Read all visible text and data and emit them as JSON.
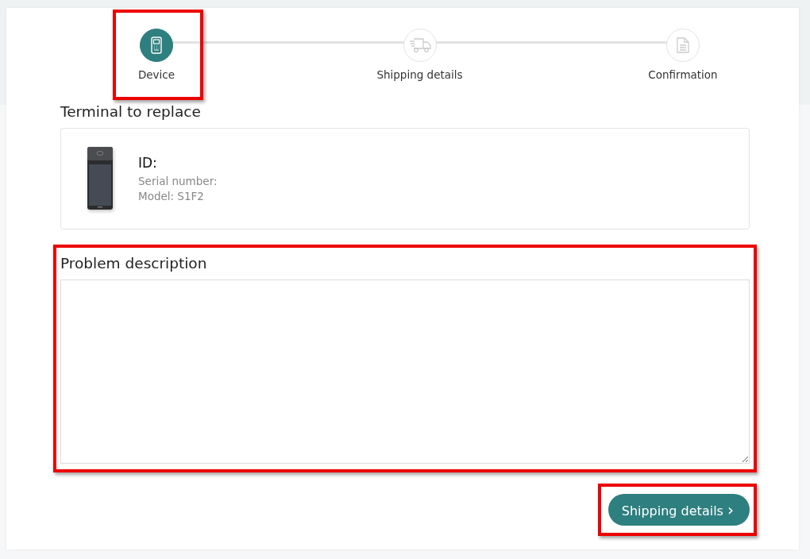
{
  "steps": [
    {
      "label": "Device",
      "kind": "terminal",
      "selected": true,
      "highlighted": true
    },
    {
      "label": "Shipping details",
      "kind": "truck",
      "selected": false,
      "highlighted": false
    },
    {
      "label": "Confirmation",
      "kind": "document",
      "selected": false,
      "highlighted": false
    }
  ],
  "terminal_section": {
    "title": "Terminal to replace",
    "id_label": "ID:",
    "serial_label": "Serial number:",
    "model_label": "Model: S1F2"
  },
  "problem": {
    "title": "Problem description",
    "highlighted": true
  },
  "next_button": {
    "label": "Shipping details",
    "icon": "›",
    "highlighted": true
  }
}
